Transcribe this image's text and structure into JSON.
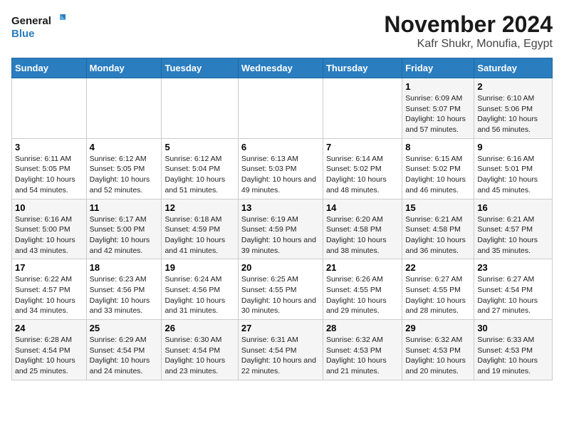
{
  "logo": {
    "line1": "General",
    "line2": "Blue"
  },
  "title": "November 2024",
  "location": "Kafr Shukr, Monufia, Egypt",
  "weekdays": [
    "Sunday",
    "Monday",
    "Tuesday",
    "Wednesday",
    "Thursday",
    "Friday",
    "Saturday"
  ],
  "weeks": [
    [
      {
        "day": "",
        "info": ""
      },
      {
        "day": "",
        "info": ""
      },
      {
        "day": "",
        "info": ""
      },
      {
        "day": "",
        "info": ""
      },
      {
        "day": "",
        "info": ""
      },
      {
        "day": "1",
        "info": "Sunrise: 6:09 AM\nSunset: 5:07 PM\nDaylight: 10 hours and 57 minutes."
      },
      {
        "day": "2",
        "info": "Sunrise: 6:10 AM\nSunset: 5:06 PM\nDaylight: 10 hours and 56 minutes."
      }
    ],
    [
      {
        "day": "3",
        "info": "Sunrise: 6:11 AM\nSunset: 5:05 PM\nDaylight: 10 hours and 54 minutes."
      },
      {
        "day": "4",
        "info": "Sunrise: 6:12 AM\nSunset: 5:05 PM\nDaylight: 10 hours and 52 minutes."
      },
      {
        "day": "5",
        "info": "Sunrise: 6:12 AM\nSunset: 5:04 PM\nDaylight: 10 hours and 51 minutes."
      },
      {
        "day": "6",
        "info": "Sunrise: 6:13 AM\nSunset: 5:03 PM\nDaylight: 10 hours and 49 minutes."
      },
      {
        "day": "7",
        "info": "Sunrise: 6:14 AM\nSunset: 5:02 PM\nDaylight: 10 hours and 48 minutes."
      },
      {
        "day": "8",
        "info": "Sunrise: 6:15 AM\nSunset: 5:02 PM\nDaylight: 10 hours and 46 minutes."
      },
      {
        "day": "9",
        "info": "Sunrise: 6:16 AM\nSunset: 5:01 PM\nDaylight: 10 hours and 45 minutes."
      }
    ],
    [
      {
        "day": "10",
        "info": "Sunrise: 6:16 AM\nSunset: 5:00 PM\nDaylight: 10 hours and 43 minutes."
      },
      {
        "day": "11",
        "info": "Sunrise: 6:17 AM\nSunset: 5:00 PM\nDaylight: 10 hours and 42 minutes."
      },
      {
        "day": "12",
        "info": "Sunrise: 6:18 AM\nSunset: 4:59 PM\nDaylight: 10 hours and 41 minutes."
      },
      {
        "day": "13",
        "info": "Sunrise: 6:19 AM\nSunset: 4:59 PM\nDaylight: 10 hours and 39 minutes."
      },
      {
        "day": "14",
        "info": "Sunrise: 6:20 AM\nSunset: 4:58 PM\nDaylight: 10 hours and 38 minutes."
      },
      {
        "day": "15",
        "info": "Sunrise: 6:21 AM\nSunset: 4:58 PM\nDaylight: 10 hours and 36 minutes."
      },
      {
        "day": "16",
        "info": "Sunrise: 6:21 AM\nSunset: 4:57 PM\nDaylight: 10 hours and 35 minutes."
      }
    ],
    [
      {
        "day": "17",
        "info": "Sunrise: 6:22 AM\nSunset: 4:57 PM\nDaylight: 10 hours and 34 minutes."
      },
      {
        "day": "18",
        "info": "Sunrise: 6:23 AM\nSunset: 4:56 PM\nDaylight: 10 hours and 33 minutes."
      },
      {
        "day": "19",
        "info": "Sunrise: 6:24 AM\nSunset: 4:56 PM\nDaylight: 10 hours and 31 minutes."
      },
      {
        "day": "20",
        "info": "Sunrise: 6:25 AM\nSunset: 4:55 PM\nDaylight: 10 hours and 30 minutes."
      },
      {
        "day": "21",
        "info": "Sunrise: 6:26 AM\nSunset: 4:55 PM\nDaylight: 10 hours and 29 minutes."
      },
      {
        "day": "22",
        "info": "Sunrise: 6:27 AM\nSunset: 4:55 PM\nDaylight: 10 hours and 28 minutes."
      },
      {
        "day": "23",
        "info": "Sunrise: 6:27 AM\nSunset: 4:54 PM\nDaylight: 10 hours and 27 minutes."
      }
    ],
    [
      {
        "day": "24",
        "info": "Sunrise: 6:28 AM\nSunset: 4:54 PM\nDaylight: 10 hours and 25 minutes."
      },
      {
        "day": "25",
        "info": "Sunrise: 6:29 AM\nSunset: 4:54 PM\nDaylight: 10 hours and 24 minutes."
      },
      {
        "day": "26",
        "info": "Sunrise: 6:30 AM\nSunset: 4:54 PM\nDaylight: 10 hours and 23 minutes."
      },
      {
        "day": "27",
        "info": "Sunrise: 6:31 AM\nSunset: 4:54 PM\nDaylight: 10 hours and 22 minutes."
      },
      {
        "day": "28",
        "info": "Sunrise: 6:32 AM\nSunset: 4:53 PM\nDaylight: 10 hours and 21 minutes."
      },
      {
        "day": "29",
        "info": "Sunrise: 6:32 AM\nSunset: 4:53 PM\nDaylight: 10 hours and 20 minutes."
      },
      {
        "day": "30",
        "info": "Sunrise: 6:33 AM\nSunset: 4:53 PM\nDaylight: 10 hours and 19 minutes."
      }
    ]
  ]
}
